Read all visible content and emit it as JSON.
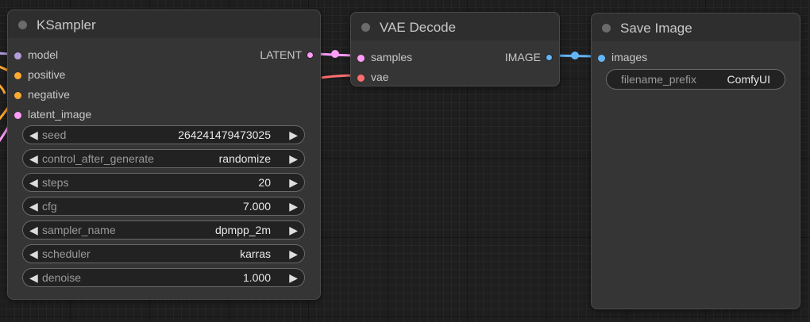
{
  "nodes": {
    "ksampler": {
      "title": "KSampler",
      "inputs": [
        {
          "label": "model",
          "color": "#b39ddb"
        },
        {
          "label": "positive",
          "color": "#ffa931"
        },
        {
          "label": "negative",
          "color": "#ffa931"
        },
        {
          "label": "latent_image",
          "color": "#ff9cf9"
        }
      ],
      "output": {
        "label": "LATENT",
        "color": "#ff9cf9"
      },
      "widgets": [
        {
          "name": "seed",
          "value": "264241479473025"
        },
        {
          "name": "control_after_generate",
          "value": "randomize"
        },
        {
          "name": "steps",
          "value": "20"
        },
        {
          "name": "cfg",
          "value": "7.000"
        },
        {
          "name": "sampler_name",
          "value": "dpmpp_2m"
        },
        {
          "name": "scheduler",
          "value": "karras"
        },
        {
          "name": "denoise",
          "value": "1.000"
        }
      ]
    },
    "vae_decode": {
      "title": "VAE Decode",
      "inputs": [
        {
          "label": "samples",
          "color": "#ff9cf9"
        },
        {
          "label": "vae",
          "color": "#ff6e6e"
        }
      ],
      "output": {
        "label": "IMAGE",
        "color": "#64b5f6"
      }
    },
    "save_image": {
      "title": "Save Image",
      "inputs": [
        {
          "label": "images",
          "color": "#64b5f6"
        }
      ],
      "widgets": [
        {
          "name": "filename_prefix",
          "value": "ComfyUI"
        }
      ]
    }
  },
  "arrows": {
    "left": "◀",
    "right": "▶"
  },
  "colors": {
    "link_latent": "#ff9cf9",
    "link_vae": "#ff6e6e",
    "link_image": "#64b5f6",
    "link_model": "#b39ddb",
    "link_conditioning": "#ffa931"
  }
}
